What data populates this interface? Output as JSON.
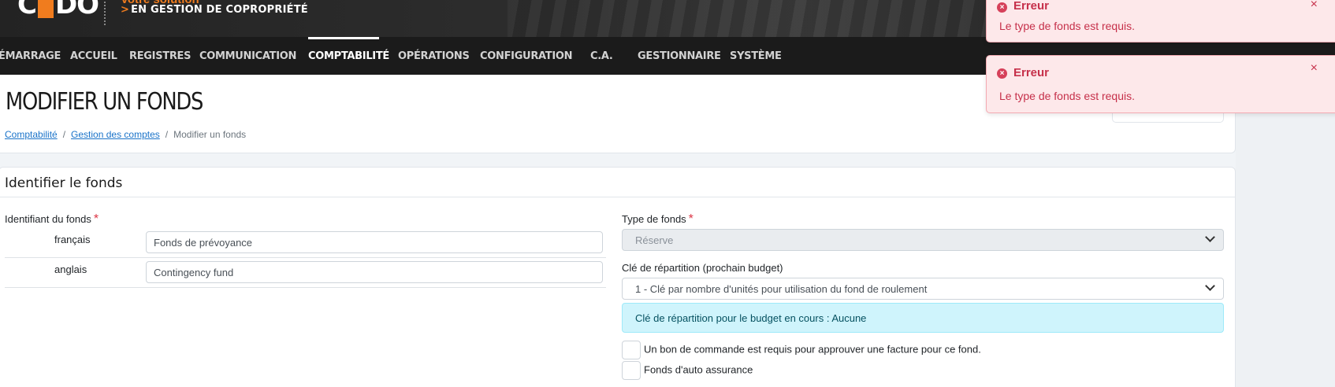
{
  "brand": {
    "logo_left": "C",
    "logo_right": "DO",
    "tagline_top": "Votre solution",
    "tagline_chevron": ">",
    "tagline": "EN GESTION DE COPROPRIÉTÉ",
    "accent": "#f07c1e"
  },
  "nav": {
    "items": [
      {
        "label": "ÉMARRAGE"
      },
      {
        "label": "ACCUEIL"
      },
      {
        "label": "REGISTRES"
      },
      {
        "label": "COMMUNICATION"
      },
      {
        "label": "COMPTABILITÉ",
        "active": true
      },
      {
        "label": "OPÉRATIONS"
      },
      {
        "label": "CONFIGURATION"
      },
      {
        "label": "C.A."
      },
      {
        "label": "GESTIONNAIRE"
      },
      {
        "label": "SYSTÈME"
      }
    ]
  },
  "page": {
    "title": "MODIFIER UN FONDS",
    "breadcrumb": [
      {
        "label": "Comptabilité",
        "link": true
      },
      {
        "label": "Gestion des comptes",
        "link": true
      },
      {
        "label": "Modifier un fonds",
        "link": false
      }
    ],
    "breadcrumb_sep": "/"
  },
  "form": {
    "section_title": "Identifier le fonds",
    "required_mark": "*",
    "identifier_label": "Identifiant du fonds",
    "languages": [
      {
        "label": "français",
        "value": "Fonds de prévoyance"
      },
      {
        "label": "anglais",
        "value": "Contingency fund"
      }
    ],
    "fund_type_label": "Type de fonds",
    "fund_type_value": "Réserve",
    "distribution_label": "Clé de répartition (prochain budget)",
    "distribution_value": "1 - Clé par nombre d'unités pour utilisation du fond de roulement",
    "info_text": "Clé de répartition pour le budget en cours : Aucune",
    "checkboxes": [
      {
        "label": "Un bon de commande est requis pour approuver une facture pour ce fond.",
        "checked": false
      },
      {
        "label": "Fonds d'auto assurance",
        "checked": false
      }
    ]
  },
  "toasts": [
    {
      "title": "Erreur",
      "message": "Le type de fonds est requis.",
      "icon": "x-circle-icon",
      "close": "×"
    },
    {
      "title": "Erreur",
      "message": "Le type de fonds est requis.",
      "icon": "x-circle-icon",
      "close": "×"
    }
  ],
  "colors": {
    "error": "#c6304a",
    "info_bg": "#cff4fc",
    "nav_bg": "#1b1b1b"
  }
}
